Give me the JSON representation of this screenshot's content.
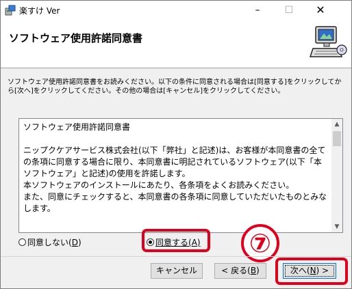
{
  "window": {
    "title": "楽すけ Ver",
    "minimize_glyph": "–",
    "maximize_glyph": "☐",
    "close_glyph": "✕",
    "app_icon": "installer-icon"
  },
  "header": {
    "title": "ソフトウェア使用許諾同意書",
    "graphic_icon": "computer-cd-icon"
  },
  "instructions": "ソフトウェア使用許諾同意書をお読みください。以下の条件に同意される場合は[同意する]をクリックしてから[次へ]をクリックしてください。その他の場合は[キャンセル]をクリックしてください。",
  "license": {
    "text": "ソフトウェア使用許諾同意書\n\nニップクケアサービス株式会社(以下「弊社」と記述)は、お客様が本同意書の全ての条項に同意する場合に限り、本同意書に明記されているソフトウェア(以下「本ソフトウェア」と記述)の使用を許諾します。\n本ソフトウェアのインストールにあたり、各条項をよくお読みください。\nまた、同意にチェックすると、本同意書の各条項に同意していただいたものとみなします。"
  },
  "radios": {
    "disagree_label": "同意しない(",
    "disagree_key": "D",
    "agree_label": "同意する(",
    "agree_key": "A",
    "selected": "agree"
  },
  "annotation": {
    "step_number": "⑦",
    "color": "#e0001b"
  },
  "buttons": {
    "cancel": "キャンセル",
    "back_label": "< 戻る(",
    "back_key": "B",
    "next_label": "次へ(",
    "next_key": "N",
    "next_suffix": ") >",
    "close_paren": ")"
  }
}
